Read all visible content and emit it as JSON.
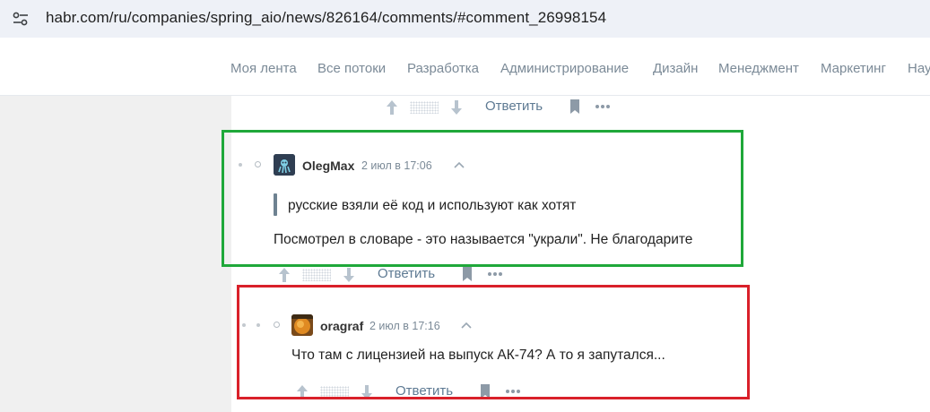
{
  "browser": {
    "url": "habr.com/ru/companies/spring_aio/news/826164/comments/#comment_26998154"
  },
  "nav": {
    "items": [
      "Моя лента",
      "Все потоки",
      "Разработка",
      "Администрирование",
      "Дизайн",
      "Менеджмент",
      "Маркетинг",
      "Нау"
    ]
  },
  "top_actions": {
    "reply_label": "Ответить"
  },
  "comment1": {
    "author": "OlegMax",
    "time": "2 июл в 17:06",
    "quote": "русские взяли её код и используют как хотят",
    "text": "Посмотрел в словаре - это называется \"украли\". Не благодарите",
    "reply_label": "Ответить"
  },
  "comment2": {
    "author": "oragraf",
    "time": "2 июл в 17:16",
    "text": "Что там с лицензией на выпуск АК-74? А то я запутался...",
    "reply_label": "Ответить"
  },
  "colors": {
    "highlight_green": "#1fa83a",
    "highlight_red": "#d9202a",
    "link": "#5e7a93"
  }
}
